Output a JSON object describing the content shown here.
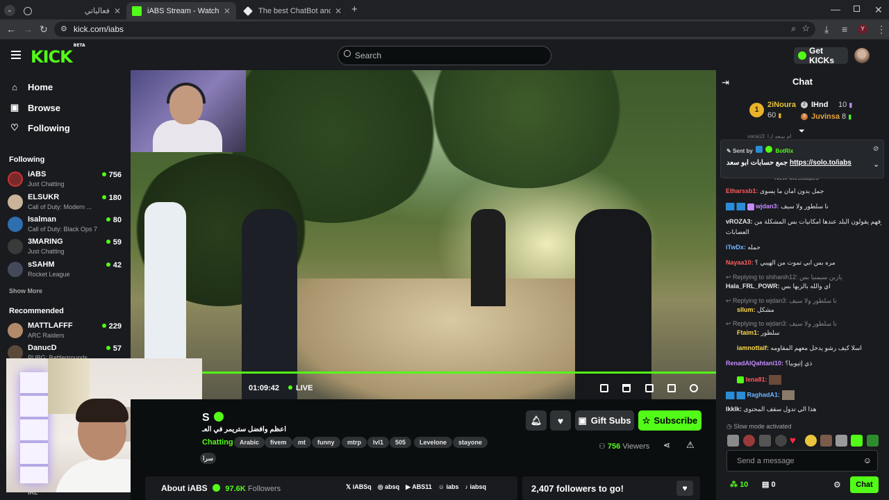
{
  "browser": {
    "tabs": [
      {
        "title": "فعالياتي",
        "active": false
      },
      {
        "title": "iABS Stream - Watch Live o",
        "active": true
      },
      {
        "title": "The best ChatBot and Widgets",
        "active": false
      }
    ],
    "url": "kick.com/iabs",
    "profile_initial": "Y"
  },
  "header": {
    "logo": "KICK",
    "logo_badge": "BETA",
    "search_placeholder": "Search",
    "get_kicks": "Get KICKs"
  },
  "sidebar": {
    "nav": [
      {
        "label": "Home",
        "icon": "home-icon"
      },
      {
        "label": "Browse",
        "icon": "browse-icon"
      },
      {
        "label": "Following",
        "icon": "heart-icon"
      }
    ],
    "following_title": "Following",
    "following": [
      {
        "name": "iABS",
        "game": "Just Chatting",
        "viewers": "756",
        "color": "#7a2a2a"
      },
      {
        "name": "ELSUKR",
        "game": "Call of Duty: Modern ...",
        "viewers": "180",
        "color": "#c9b49a"
      },
      {
        "name": "Isalman",
        "game": "Call of Duty: Black Ops 7",
        "viewers": "80",
        "color": "#2f6fb0"
      },
      {
        "name": "3MARING",
        "game": "Just Chatting",
        "viewers": "59",
        "color": "#3a3a3a"
      },
      {
        "name": "sSAHM",
        "game": "Rocket League",
        "viewers": "42",
        "color": "#444a5a"
      }
    ],
    "show_more": "Show More",
    "recommended_title": "Recommended",
    "recommended": [
      {
        "name": "MATTLAFFF",
        "game": "ARC Raiders",
        "viewers": "229",
        "color": "#b28a6a"
      },
      {
        "name": "DanucD",
        "game": "PUBG: Battlegrounds",
        "viewers": "57",
        "color": "#5a4a3a"
      }
    ],
    "partial_label": "IRL"
  },
  "player": {
    "time": "01:09:42",
    "live_label": "LIVE"
  },
  "stream": {
    "channel_name": "S",
    "title": "اعظم وافضل ستريمر في العـ",
    "category": "Chatting",
    "tags": [
      "Arabic",
      "fivem",
      "mt",
      "funny",
      "mtrp",
      "lvl1",
      "505",
      "Levelone",
      "stayone"
    ],
    "extra_tag": "سرا",
    "viewers_count": "756",
    "viewers_label": "Viewers",
    "gift_subs": "Gift Subs",
    "subscribe": "Subscribe"
  },
  "about": {
    "label": "About iABS",
    "followers_count": "97.6K",
    "followers_label": "Followers",
    "socials": [
      "iABSq",
      "absq",
      "ABS11",
      "iabs",
      "iabsq"
    ]
  },
  "goal": {
    "text": "2,407 followers to go!"
  },
  "chat": {
    "title": "Chat",
    "leaderboard": [
      {
        "rank": "1",
        "name": "2iNoura",
        "score": "60"
      },
      {
        "rank": "2",
        "name": "IHnd",
        "score": "10"
      },
      {
        "rank": "3",
        "name": "Juvinsa",
        "score": "8"
      }
    ],
    "pinned": {
      "sent_by_label": "Sent by",
      "bot": "BotRix",
      "text": "جمع حسابات ابو سعد",
      "link": "https://solo.to/iabs"
    },
    "partial_top": "varaú3: ام سعه ارا",
    "partial_new": "New Messages",
    "messages": [
      {
        "type": "msg",
        "user": "Etharssb1:",
        "color": "#ff5a5a",
        "text": "جمل بدون امان ما يسوى"
      },
      {
        "type": "msg",
        "user": "wjdan3:",
        "color": "#c58aff",
        "text": "نا سلطور ولا سيف"
      },
      {
        "type": "msg",
        "user": "vROZA3:",
        "color": "#e6e6e6",
        "text": "ماشوفهم يقولون البلد عندها امكانيات بس المشكلة من"
      },
      {
        "type": "cont",
        "text": "العصابات"
      },
      {
        "type": "msg",
        "user": "iTwDx:",
        "color": "#6fb7ff",
        "text": "حمله"
      },
      {
        "type": "msg",
        "user": "Nayaa10:",
        "color": "#ff5a5a",
        "text": "مره بس ابي تموت من الهيبي ؟"
      },
      {
        "type": "reply",
        "text": "Replying to shihanih12: ياربن سيمنيا بس"
      },
      {
        "type": "msg",
        "user": "Hala_FRL_POWR:",
        "color": "#e6e6e6",
        "text": "اي والله بالزبها بس"
      },
      {
        "type": "reply",
        "text": "Replying to wjdan3: نا سلطور ولا سيف"
      },
      {
        "type": "msg",
        "user": "sllum:",
        "color": "#ffd84a",
        "text": "مشكل"
      },
      {
        "type": "reply",
        "text": "Replying to wjdan3: نا سلطور ولا سيف"
      },
      {
        "type": "msg",
        "user": "Ftaim1:",
        "color": "#ffd84a",
        "text": "سلطور"
      },
      {
        "type": "msg",
        "user": "iamnottaif:",
        "color": "#ffd84a",
        "text": "اسلا كيف رشو يدخل معهم المقاومه"
      },
      {
        "type": "msg",
        "user": "RenadAlQahtani10:",
        "color": "#c58aff",
        "text": "ذي إثيوبيا؟"
      },
      {
        "type": "msg",
        "user": "lena81:",
        "color": "#ff5a5a",
        "text": ""
      },
      {
        "type": "msg",
        "user": "RaghadA1:",
        "color": "#6fb7ff",
        "text": ""
      },
      {
        "type": "msg",
        "user": "lkklk:",
        "color": "#e6e6e6",
        "text": "هذا الي تدول سقف المحتوى"
      }
    ],
    "slow_mode": "Slow mode activated",
    "send_placeholder": "Send a message",
    "kicks": "10",
    "points": "0",
    "chat_button": "Chat"
  }
}
